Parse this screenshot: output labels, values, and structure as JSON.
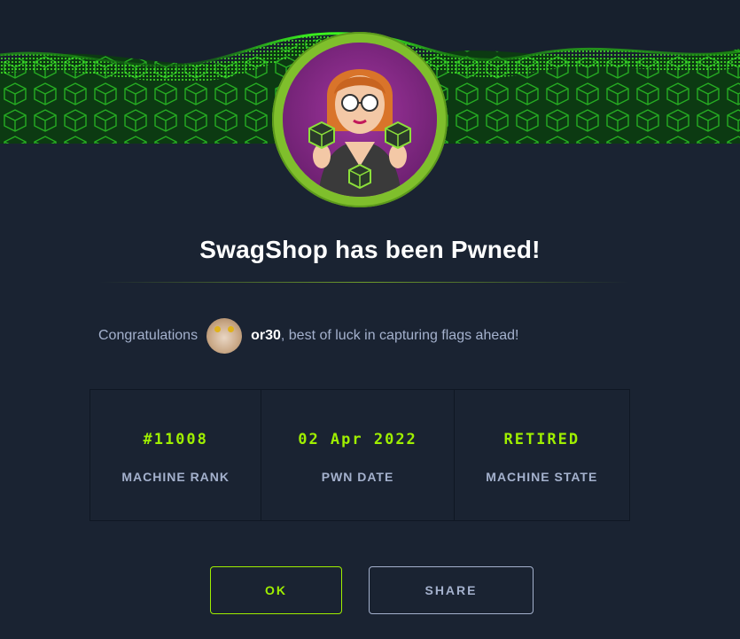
{
  "header": {
    "title": "SwagShop has been Pwned!"
  },
  "congrats": {
    "prefix": "Congratulations",
    "username": "or30",
    "suffix": ", best of luck in capturing flags ahead!"
  },
  "stats": [
    {
      "value": "#11008",
      "label": "MACHINE RANK"
    },
    {
      "value": "02 Apr 2022",
      "label": "PWN DATE"
    },
    {
      "value": "RETIRED",
      "label": "MACHINE STATE"
    }
  ],
  "buttons": {
    "ok_label": "OK",
    "share_label": "SHARE"
  },
  "colors": {
    "accent": "#9fef00",
    "background": "#1a2332",
    "muted_text": "#a4b1cd"
  }
}
